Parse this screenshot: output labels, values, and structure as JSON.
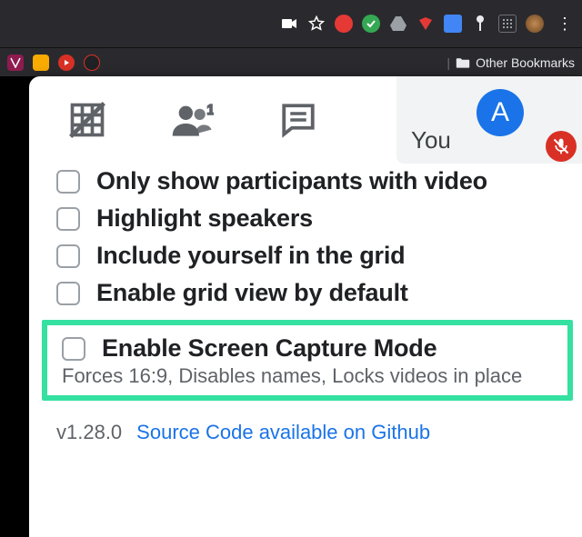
{
  "browser": {
    "bookmarks_label": "Other Bookmarks"
  },
  "pill": {
    "you": "You",
    "avatar_letter": "A"
  },
  "options": [
    {
      "label": "Only show participants with video"
    },
    {
      "label": "Highlight speakers"
    },
    {
      "label": "Include yourself in the grid"
    },
    {
      "label": "Enable grid view by default"
    }
  ],
  "highlighted": {
    "label": "Enable Screen Capture Mode",
    "sub": "Forces 16:9, Disables names, Locks videos in place"
  },
  "footer": {
    "version": "v1.28.0",
    "link": "Source Code available on Github"
  }
}
